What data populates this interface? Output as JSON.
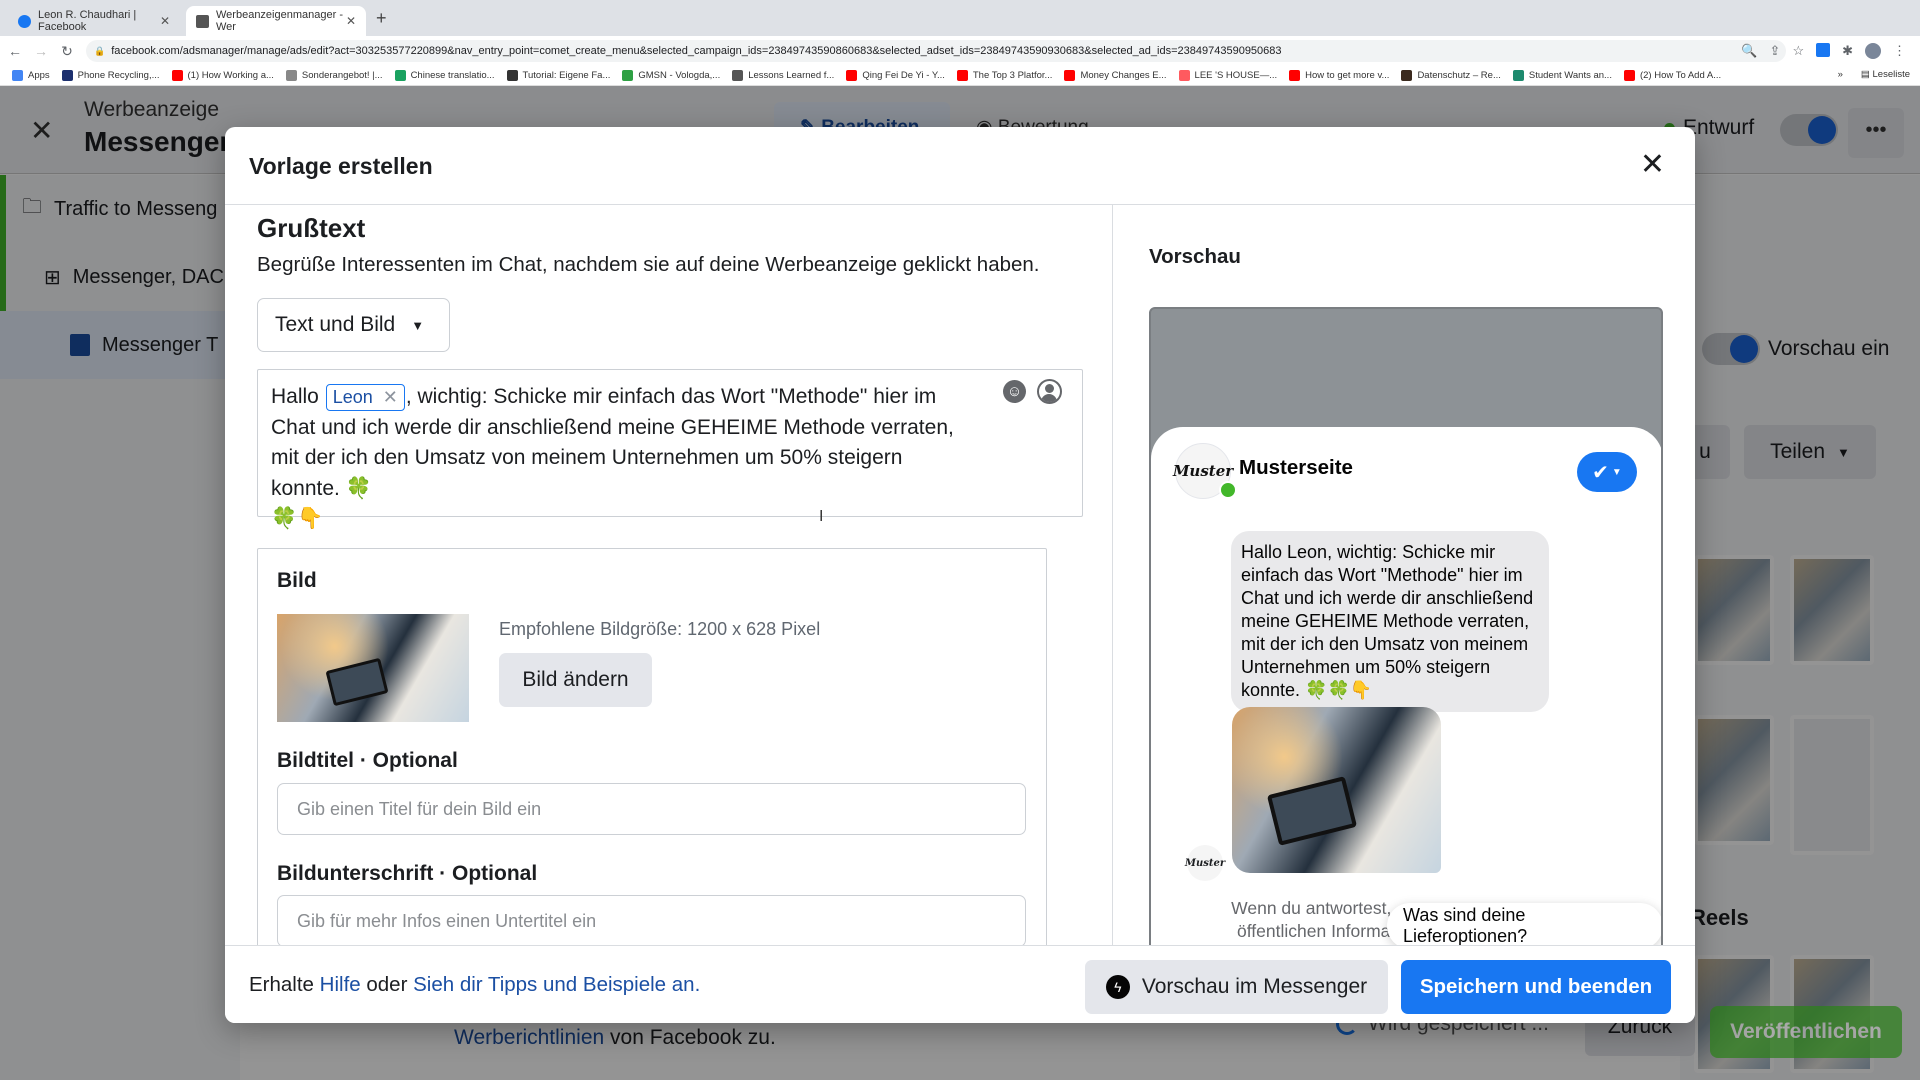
{
  "browser": {
    "tabs": [
      {
        "title": "Leon R. Chaudhari | Facebook",
        "active": false
      },
      {
        "title": "Werbeanzeigenmanager - Wer",
        "active": true
      }
    ],
    "new_tab": "+",
    "url": "facebook.com/adsmanager/manage/ads/edit?act=303253577220899&nav_entry_point=comet_create_menu&selected_campaign_ids=23849743590860683&selected_adset_ids=23849743590930683&selected_ad_ids=23849743590950683",
    "bookmarks": [
      {
        "label": "Apps",
        "color": "#4285f4"
      },
      {
        "label": "Phone Recycling,...",
        "color": "#1c2f6e"
      },
      {
        "label": "(1) How Working a...",
        "color": "#ff0000"
      },
      {
        "label": "Sonderangebot! |...",
        "color": "#888888"
      },
      {
        "label": "Chinese translatio...",
        "color": "#1aa260"
      },
      {
        "label": "Tutorial: Eigene Fa...",
        "color": "#333333"
      },
      {
        "label": "GMSN - Vologda,...",
        "color": "#2ea043"
      },
      {
        "label": "Lessons Learned f...",
        "color": "#555555"
      },
      {
        "label": "Qing Fei De Yi - Y...",
        "color": "#ff0000"
      },
      {
        "label": "The Top 3 Platfor...",
        "color": "#ff0000"
      },
      {
        "label": "Money Changes E...",
        "color": "#ff0000"
      },
      {
        "label": "LEE 'S HOUSE—...",
        "color": "#ff5a5f"
      },
      {
        "label": "How to get more v...",
        "color": "#ff0000"
      },
      {
        "label": "Datenschutz – Re...",
        "color": "#3b2a1e"
      },
      {
        "label": "Student Wants an...",
        "color": "#1d8a6e"
      },
      {
        "label": "(2) How To Add A...",
        "color": "#ff0000"
      }
    ],
    "bookmarks_more": "»",
    "reading_list": "Leseliste"
  },
  "page": {
    "header_subtitle": "Werbeanzeige",
    "header_title": "Messenger",
    "tab_edit": "Bearbeiten",
    "tab_review": "Bewertung",
    "status": "Entwurf",
    "more": "•••",
    "sidebar": [
      {
        "label": "Traffic to Messeng",
        "icon": "folder-icon"
      },
      {
        "label": "Messenger, DAC",
        "icon": "grid-icon"
      },
      {
        "label": "Messenger T",
        "icon": "ad-icon"
      }
    ],
    "preview_toggle_label": "Vorschau ein",
    "right_btn_partial": "u",
    "share_label": "Teilen",
    "reels_label": "Reels",
    "footer_line1": "...",
    "footer_link": "Werberichtlinien",
    "footer_rest": " von Facebook zu.",
    "saving": "Wird gespeichert ...",
    "back": "Zurück",
    "publish": "Veröffentlichen"
  },
  "modal": {
    "title": "Vorlage erstellen",
    "greeting": {
      "heading": "Grußtext",
      "description": "Begrüße Interessenten im Chat, nachdem sie auf deine Werbeanzeige geklickt haben.",
      "format_selected": "Text und Bild",
      "message_prefix": "Hallo",
      "token": "Leon",
      "message_rest": ", wichtig: Schicke mir einfach das Wort \"Methode\" hier im Chat und ich werde dir anschließend meine GEHEIME Methode verraten, mit der ich den Umsatz von meinem Unternehmen um 50% steigern konnte. 🍀",
      "message_line2": "🍀👇"
    },
    "image": {
      "heading": "Bild",
      "recommended": "Empfohlene Bildgröße: 1200 x 628 Pixel",
      "change_button": "Bild ändern",
      "title_label": "Bildtitel",
      "caption_label": "Bildunterschrift",
      "optional": " · Optional",
      "title_placeholder": "Gib einen Titel für dein Bild ein",
      "caption_placeholder": "Gib für mehr Infos einen Untertitel ein"
    },
    "preview": {
      "heading": "Vorschau",
      "page_name": "Musterseite",
      "avatar_text": "Muster",
      "message": "Hallo Leon, wichtig: Schicke mir einfach das Wort \"Methode\" hier im Chat und ich werde dir anschließend meine GEHEIME Methode verraten, mit der ich den Umsatz von meinem Unternehmen um 50% steigern konnte. 🍀🍀👇",
      "disclaimer": "Wenn du antwortest, ... öffentlichen Informa...",
      "quick_reply": "Was sind deine Lieferoptionen?"
    },
    "footer": {
      "text_prefix": "Erhalte ",
      "help_link": "Hilfe",
      "text_mid": " oder ",
      "tips_link": "Sieh dir Tipps und Beispiele an.",
      "preview_button": "Vorschau im Messenger",
      "save_button": "Speichern und beenden"
    }
  }
}
